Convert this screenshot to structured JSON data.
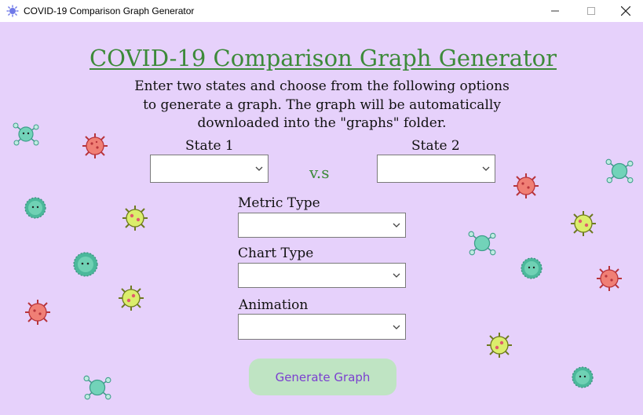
{
  "window": {
    "title": "COVID-19 Comparison Graph Generator"
  },
  "header": {
    "title": "COVID-19 Comparison Graph Generator"
  },
  "description": [
    "Enter two states and choose from the following options",
    "to generate a graph. The graph will be automatically",
    "downloaded into the \"graphs\" folder."
  ],
  "state1": {
    "label": "State 1",
    "value": ""
  },
  "vs_label": "v.s",
  "state2": {
    "label": "State 2",
    "value": ""
  },
  "metric": {
    "label": "Metric Type",
    "value": ""
  },
  "chart": {
    "label": "Chart Type",
    "value": ""
  },
  "animation": {
    "label": "Animation",
    "value": ""
  },
  "generate_button": "Generate Graph",
  "colors": {
    "background": "#e6d1fb",
    "title_green": "#3d8a3a",
    "button_bg": "#bfe4c3",
    "button_text": "#7b3fd0"
  },
  "icons": [
    "virus-icon",
    "minimize-icon",
    "maximize-icon",
    "close-icon",
    "app-icon"
  ]
}
